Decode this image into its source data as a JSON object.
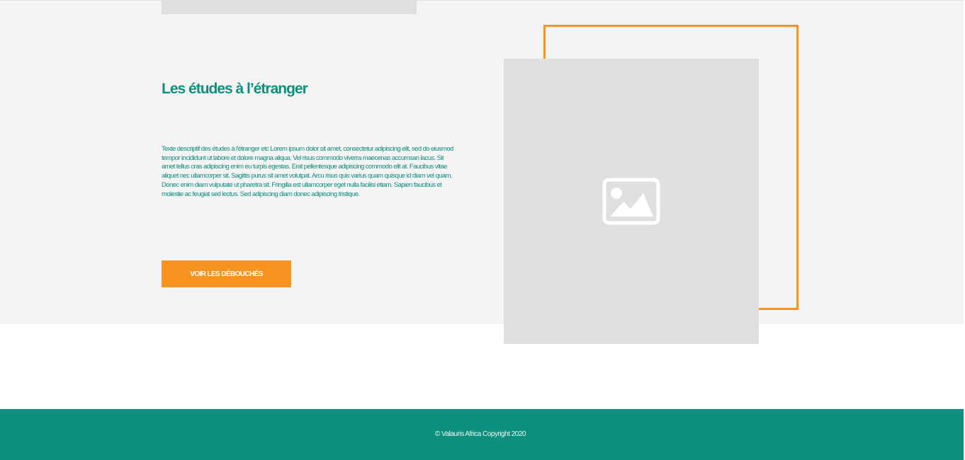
{
  "section": {
    "title": "Les études à l’étranger",
    "description": "Texte descriptif des études à l'étranger etc Lorem ipsum dolor sit amet, consectetur adipiscing elit, sed do eiusmod tempor incididunt ut labore et dolore magna aliqua. Vel risus commodo viverra maecenas accumsan lacus. Sit amet tellus cras adipiscing enim eu turpis egestas. Erat pellentesque adipiscing commodo elit at. Faucibus vitae aliquet nec ullamcorper sit. Sagittis purus sit amet volutpat. Arcu risus quis varius quam quisque id diam vel quam. Donec enim diam vulputate ut pharetra sit. Fringilla est ullamcorper eget nulla facilisi etiam. Sapien faucibus et molestie ac feugiat sed lectus. Sed adipiscing diam donec adipiscing tristique.",
    "button_label": "VOIR LES DÉBOUCHÉS",
    "image_icon": "image-placeholder-icon"
  },
  "footer": {
    "copyright": "© Valauris Africa Copyright 2020"
  },
  "colors": {
    "accent_teal": "#0f8f7e",
    "accent_orange": "#f7931e",
    "section_background": "#f4f4f4",
    "placeholder_gray": "#dfdfdf"
  }
}
